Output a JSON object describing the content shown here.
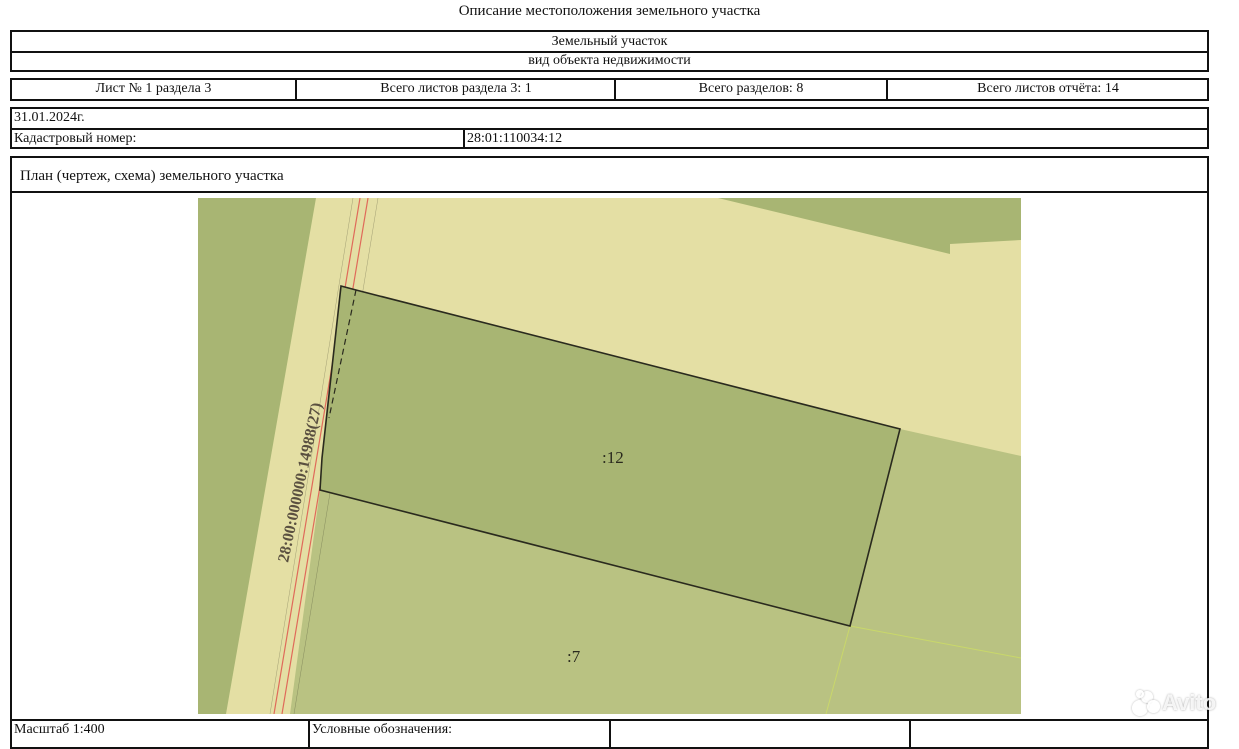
{
  "document": {
    "title": "Описание местоположения земельного участка",
    "object_name": "Земельный участок",
    "object_type": "вид объекта недвижимости"
  },
  "sheet_info": {
    "sheet": "Лист № 1 раздела 3",
    "sheets_in_section": "Всего листов раздела 3: 1",
    "total_sections": "Всего разделов: 8",
    "total_sheets": "Всего листов отчёта: 14"
  },
  "record": {
    "date": "31.01.2024г.",
    "cadastral_label": "Кадастровый номер:",
    "cadastral_number": "28:01:110034:12"
  },
  "plan": {
    "heading": "План (чертеж, схема) земельного участка",
    "road_label": "28:00:000000:14988(27)",
    "parcel_main_label": ":12",
    "parcel_lower_label": ":7"
  },
  "footer": {
    "scale": "Масштаб 1:400",
    "legend": "Условные обозначения:"
  },
  "watermark": {
    "text": "Avito"
  },
  "colors": {
    "map_light": "#e4dfa4",
    "map_dark": "#a8b573",
    "map_mid": "#b9c282",
    "parcel_border": "#2a2a1e",
    "red_line": "#e06a5a",
    "grid_line": "#c9d86a"
  }
}
